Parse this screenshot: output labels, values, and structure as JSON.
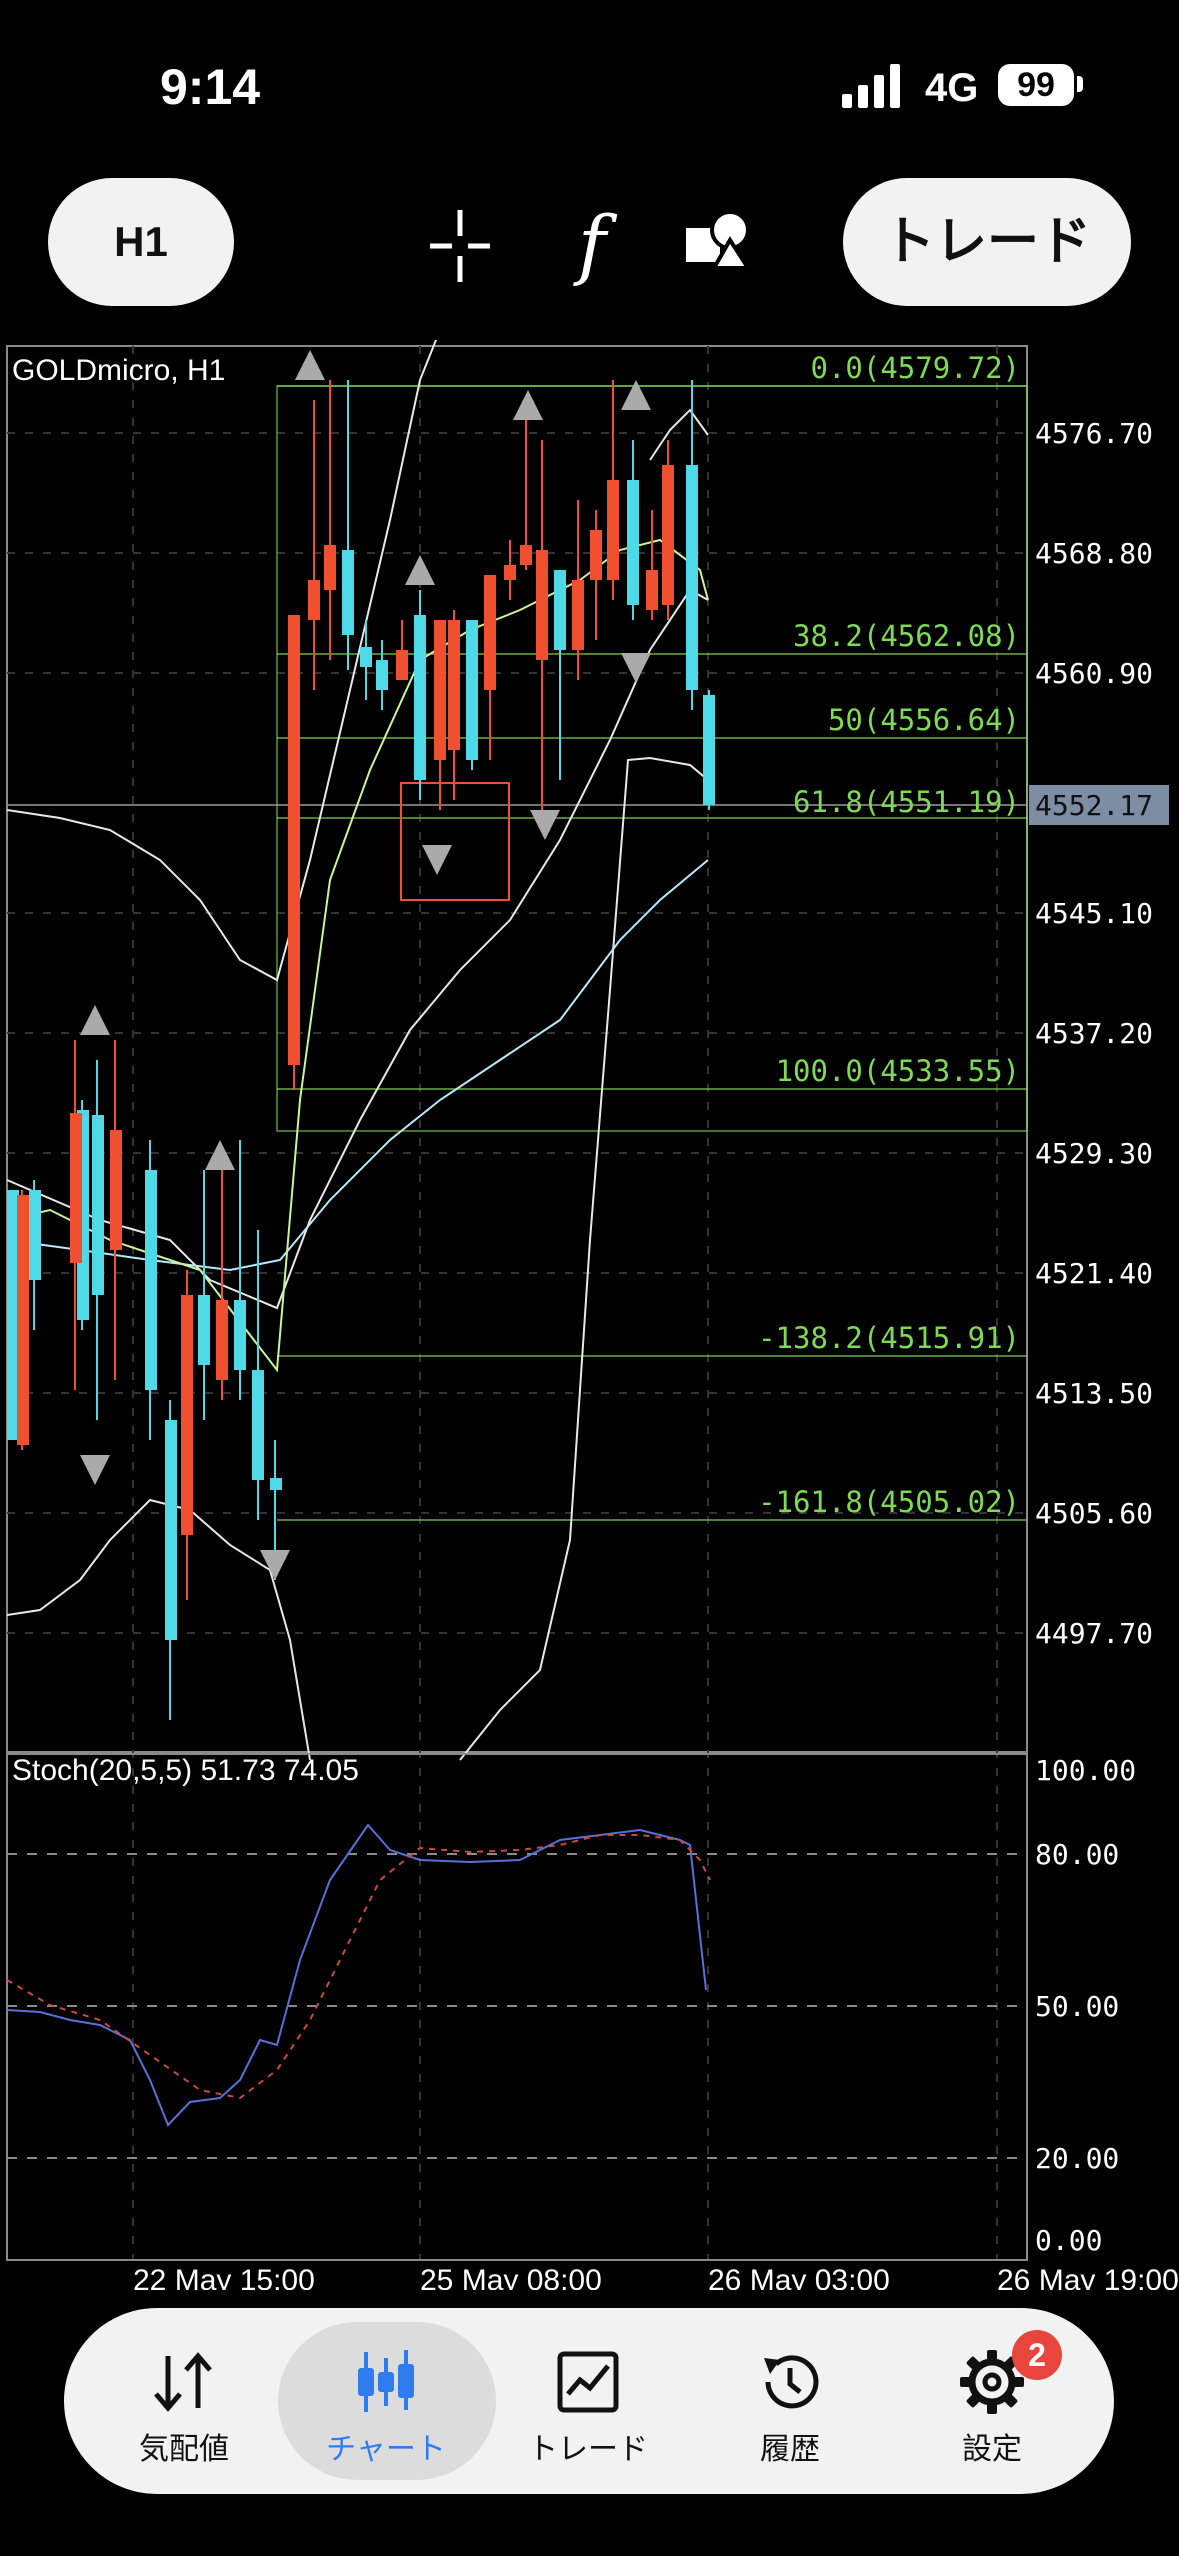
{
  "status": {
    "time": "9:14",
    "network": "4G",
    "battery": "99"
  },
  "toolbar": {
    "timeframe_label": "H1",
    "trade_label": "トレード",
    "function_label": "f"
  },
  "chart": {
    "title": "GOLDmicro, H1",
    "current_price": "4552.17",
    "stoch_label": "Stoch(20,5,5) 51.73 74.05",
    "price_axis": [
      "4576.70",
      "4568.80",
      "4560.90",
      "4545.10",
      "4537.20",
      "4529.30",
      "4521.40",
      "4513.50",
      "4505.60",
      "4497.70"
    ],
    "stoch_axis": [
      "100.00",
      "80.00",
      "50.00",
      "20.00",
      "0.00"
    ],
    "time_axis": [
      "22 May 15:00",
      "25 May 08:00",
      "26 May 03:00",
      "26 May 19:00"
    ],
    "fib_levels": [
      "0.0(4579.72)",
      "38.2(4562.08)",
      "50(4556.64)",
      "61.8(4551.19)",
      "100.0(4533.55)",
      "-138.2(4515.91)",
      "-161.8(4505.02)"
    ],
    "colors": {
      "bull": "#4dd9e6",
      "bear": "#f0502f",
      "fib": "#7ed957",
      "grid": "#3a3a3a"
    }
  },
  "tabs": [
    {
      "label": "気配値",
      "icon": "arrows-updown-icon"
    },
    {
      "label": "チャート",
      "icon": "candles-icon"
    },
    {
      "label": "トレード",
      "icon": "chart-line-icon"
    },
    {
      "label": "履歴",
      "icon": "history-icon"
    },
    {
      "label": "設定",
      "icon": "gear-icon"
    }
  ],
  "settings_badge": "2"
}
